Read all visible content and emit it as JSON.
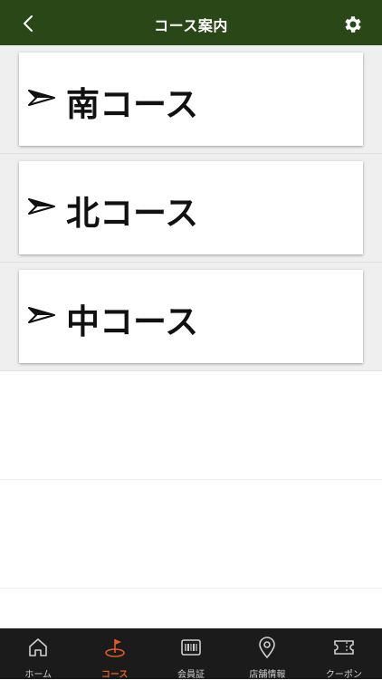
{
  "header": {
    "title": "コース案内",
    "background": "#2a4717"
  },
  "courses": [
    {
      "label": "南コース",
      "icon": "arrow-right-icon"
    },
    {
      "label": "北コース",
      "icon": "arrow-right-icon"
    },
    {
      "label": "中コース",
      "icon": "arrow-right-icon"
    }
  ],
  "tabbar": {
    "active_color": "#e05a2a",
    "items": [
      {
        "label": "ホーム",
        "icon": "home-icon",
        "active": false
      },
      {
        "label": "コース",
        "icon": "golf-flag-icon",
        "active": true
      },
      {
        "label": "会員証",
        "icon": "barcode-icon",
        "active": false
      },
      {
        "label": "店舗情報",
        "icon": "map-pin-icon",
        "active": false
      },
      {
        "label": "クーポン",
        "icon": "ticket-icon",
        "active": false
      }
    ]
  }
}
